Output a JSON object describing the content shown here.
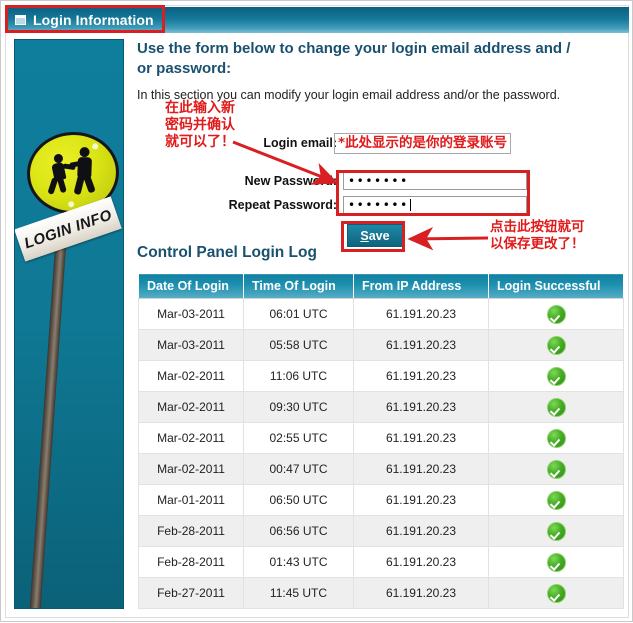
{
  "header": {
    "title": "Login Information",
    "icon": "window-icon"
  },
  "photo": {
    "placard_text": "LOGIN INFO",
    "sky_color": "#0f7894",
    "sign_color": "#dbe514"
  },
  "main": {
    "heading": "Use the form below to change your login email address and / or password:",
    "subtext": "In this section you can modify your login email address and/or the password.",
    "form": {
      "email_label": "Login email:",
      "new_password_label": "New Password:",
      "repeat_password_label": "Repeat Password:",
      "new_password_value": "•••••••",
      "repeat_password_value": "•••••••",
      "save_label_prefix": "",
      "save_label_accesskey": "S",
      "save_label_rest": "ave"
    },
    "log_title": "Control Panel Login Log"
  },
  "annotations": {
    "header_box": "red-highlight-box",
    "note_left": "在此输入新\n密码并确认\n就可以了！",
    "note_right": "*此处显示的是你的登录账号",
    "note_save": "点击此按钮就可\n以保存更改了！"
  },
  "table": {
    "columns": [
      "Date Of Login",
      "Time Of Login",
      "From IP Address",
      "Login Successful"
    ],
    "rows": [
      {
        "date": "Mar-03-2011",
        "time": "06:01 UTC",
        "ip": "61.191.20.23",
        "success": true
      },
      {
        "date": "Mar-03-2011",
        "time": "05:58 UTC",
        "ip": "61.191.20.23",
        "success": true
      },
      {
        "date": "Mar-02-2011",
        "time": "11:06 UTC",
        "ip": "61.191.20.23",
        "success": true
      },
      {
        "date": "Mar-02-2011",
        "time": "09:30 UTC",
        "ip": "61.191.20.23",
        "success": true
      },
      {
        "date": "Mar-02-2011",
        "time": "02:55 UTC",
        "ip": "61.191.20.23",
        "success": true
      },
      {
        "date": "Mar-02-2011",
        "time": "00:47 UTC",
        "ip": "61.191.20.23",
        "success": true
      },
      {
        "date": "Mar-01-2011",
        "time": "06:50 UTC",
        "ip": "61.191.20.23",
        "success": true
      },
      {
        "date": "Feb-28-2011",
        "time": "06:56 UTC",
        "ip": "61.191.20.23",
        "success": true
      },
      {
        "date": "Feb-28-2011",
        "time": "01:43 UTC",
        "ip": "61.191.20.23",
        "success": true
      },
      {
        "date": "Feb-27-2011",
        "time": "11:45 UTC",
        "ip": "61.191.20.23",
        "success": true
      }
    ]
  },
  "colors": {
    "header_teal": "#15789a",
    "heading_navy": "#1b5170",
    "annotation_red": "#e01b1b",
    "highlight_box": "#d81f21",
    "success_green": "#46ad25"
  }
}
